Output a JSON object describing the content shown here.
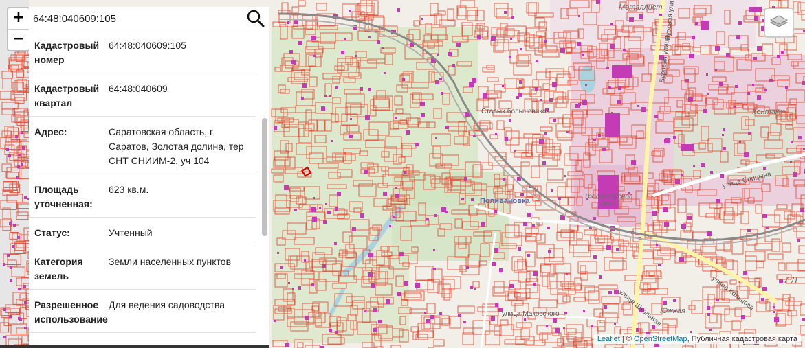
{
  "search": {
    "value": "64:48:040609:105"
  },
  "zoom": {
    "in_label": "+",
    "out_label": "−"
  },
  "info": [
    {
      "key": "Кадастровый номер",
      "value": "64:48:040609:105"
    },
    {
      "key": "Кадастровый квартал",
      "value": "64:48:040609"
    },
    {
      "key": "Адрес:",
      "value": "Саратовская область, г Саратов, Золотая долина, тер СНТ СНИИМ-2, уч 104"
    },
    {
      "key": "Площадь уточненная:",
      "value": "623 кв.м."
    },
    {
      "key": "Статус:",
      "value": "Учтенный"
    },
    {
      "key": "Категория земель",
      "value": "Земли населенных пунктов"
    },
    {
      "key": "Разрешенное использование",
      "value": "Для ведения садоводства"
    }
  ],
  "map_labels": {
    "metallist": "Металлист",
    "burovaya_1": "Буровая улица",
    "burovaya_2": "Буровая ули",
    "kontakt": "Контакт",
    "starykh_bolshevikov": "Старых большевиков",
    "ulitsa_spitsyna": "улица Спицына",
    "trolleybus_depo": "Троллейбусное депо",
    "polivanovka": "Поливановка",
    "kolotsova": "улица Кольцова",
    "makovskogo": "улица Маковского",
    "shkolnaya": "улица Школьная",
    "yuzhnaya": "Южная",
    "grid_7": "7 Л"
  },
  "attribution": {
    "leaflet": "Leaflet",
    "separator": " | © ",
    "osm": "OpenStreetMap",
    "rest": ", Публичная кадастровая карта"
  },
  "colors": {
    "parcel_outline": "#e8513a",
    "building": "#c43bb5",
    "green": "#d6e7c4",
    "industrial": "#ebd0de",
    "railway": "#8a8a8a",
    "water": "#aad3df",
    "highlight": "#e00000"
  }
}
